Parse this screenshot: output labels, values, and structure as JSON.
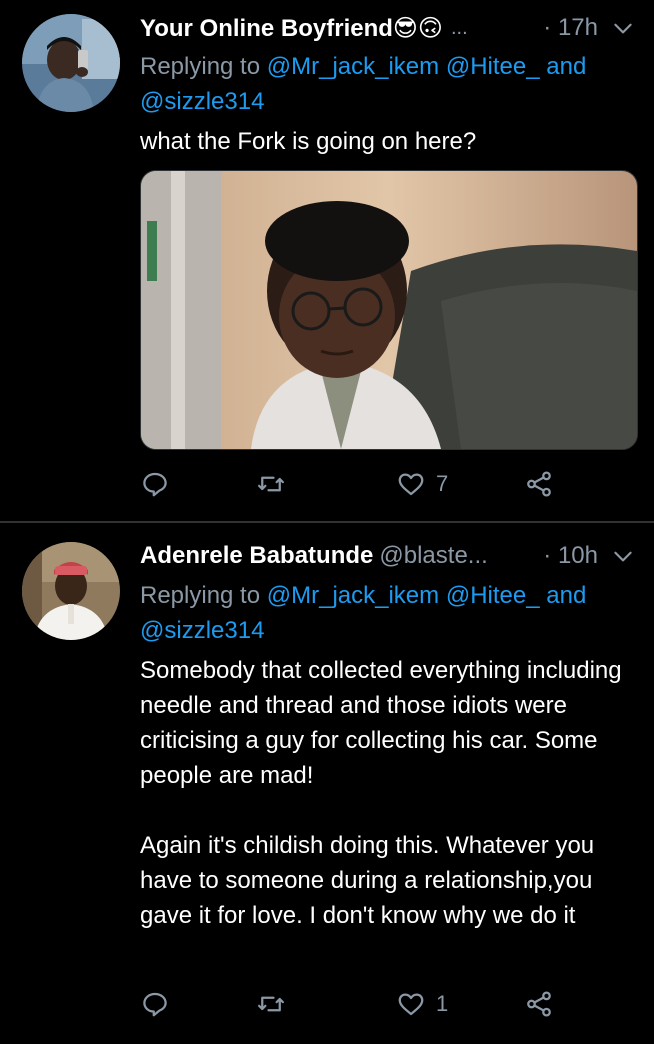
{
  "tweets": [
    {
      "author_name": "Your Online Boyfriend😎🙃",
      "handle": "",
      "overflow_dots": "...",
      "time": "· 17h",
      "replying_prefix": "Replying to",
      "mentions": [
        "@Mr_jack_ikem",
        "@Hitee_"
      ],
      "mention_joiner": "and",
      "mention_last": "@sizzle314",
      "text": "what the Fork is going on here?",
      "has_media": true,
      "reply_count": "",
      "retweet_count": "",
      "like_count": "7"
    },
    {
      "author_name": "Adenrele Babatunde",
      "handle": "@blaste...",
      "overflow_dots": "",
      "time": "· 10h",
      "replying_prefix": "Replying to",
      "mentions": [
        "@Mr_jack_ikem",
        "@Hitee_"
      ],
      "mention_joiner": "and",
      "mention_last": "@sizzle314",
      "text_p1": "Somebody that collected everything including needle and thread and those idiots were criticising a guy for collecting his car. Some people are mad!",
      "text_p2": "Again it's childish doing this. Whatever you have to someone during a relationship,you gave it for love. I don't know why we do it",
      "has_media": false,
      "reply_count": "",
      "retweet_count": "",
      "like_count": "1"
    }
  ],
  "colors": {
    "background": "#000000",
    "text": "#ffffff",
    "secondary": "#8b98a5",
    "link": "#1d9bf0",
    "divider": "#2f3336"
  },
  "icons": [
    "reply-icon",
    "retweet-icon",
    "like-icon",
    "share-icon",
    "caret-down-icon"
  ]
}
